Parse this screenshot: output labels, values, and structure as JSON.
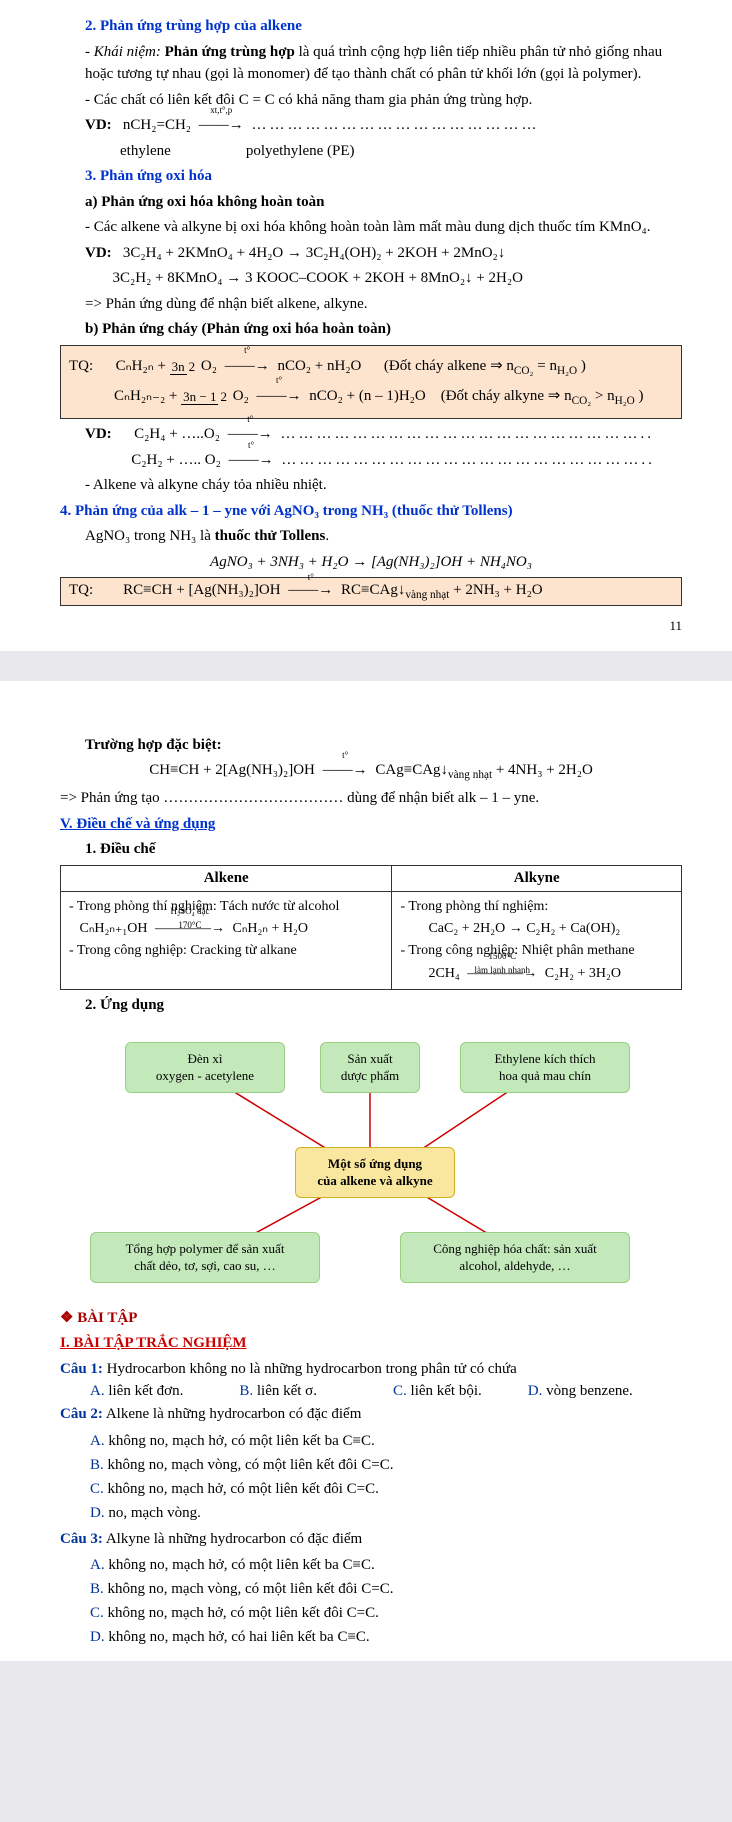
{
  "p1": {
    "h2": "2. Phản ứng trùng hợp của alkene",
    "khai_niem_label": "- Khái niệm:",
    "khai_niem": " Phản ứng trùng hợp",
    "khai_niem_text": " là quá trình cộng hợp liên tiếp nhiều phân tử nhỏ giống nhau hoặc tương tự nhau (gọi là monomer) để tạo thành chất có phân tử khối lớn (gọi là polymer).",
    "line_cc": "- Các chất có liên kết đôi C = C có khả năng tham gia phản ứng trùng hợp.",
    "vd_label": "VD:",
    "vd_eq": "nCH₂=CH₂",
    "vd_cond": "xt,t°,p",
    "vd_dots": "…………………………………………",
    "ethylene": "ethylene",
    "pe": "polyethylene (PE)",
    "h3": "3. Phản ứng oxi hóa",
    "h3a": "a) Phản ứng oxi hóa không hoàn toàn",
    "oxi_text": "- Các alkene và alkyne bị oxi hóa không hoàn toàn làm mất màu dung dịch thuốc tím KMnO₄.",
    "vd2_l1": "3C₂H₄ + 2KMnO₄ + 4H₂O → 3C₂H₄(OH)₂ + 2KOH + 2MnO₂↓",
    "vd2_l2": "3C₂H₂ + 8KMnO₄ → 3 KOOC–COOK + 2KOH + 8MnO₂↓ + 2H₂O",
    "nhan_biet": "=> Phản ứng dùng để nhận biết alkene, alkyne.",
    "h3b": "b) Phản ứng cháy (Phản ứng oxi hóa hoàn toàn)",
    "tq_label": "TQ:",
    "tq_eq1_left": "CₙH₂ₙ + ",
    "tq_eq1_frac_t": "3n",
    "tq_eq1_frac_b": "2",
    "tq_eq1_right": " O₂",
    "tq_eq1_prod": "nCO₂ + nH₂O",
    "tq_eq1_note": "(Đốt cháy alkene ⇒ n",
    "tq_eq1_co2": "CO₂",
    "tq_eq1_eq": " = n",
    "tq_eq1_h2o": "H₂O",
    "tq_eq1_close": " )",
    "tq_eq2_left": "CₙH₂ₙ₋₂ + ",
    "tq_eq2_frac_t": "3n − 1",
    "tq_eq2_frac_b": "2",
    "tq_eq2_prod": "nCO₂ + (n – 1)H₂O",
    "tq_eq2_note": "(Đốt cháy alkyne ⇒ n",
    "tq_eq2_gt": " > n",
    "vd3_l1": "C₂H₄  +  …..O₂",
    "vd3_dots": "……………………………………………………..",
    "vd3_l2": "C₂H₂  +  ….. O₂",
    "heat_note": "- Alkene và alkyne cháy tỏa nhiều nhiệt.",
    "h4": "4. Phản ứng của alk – 1 – yne với AgNO₃ trong NH₃ (thuốc thử Tollens)",
    "tollens": "AgNO₃ trong NH₃ là ",
    "tollens_bold": "thuốc thử Tollens",
    "tollens_eq": "AgNO₃ + 3NH₃ + H₂O → [Ag(NH₃)₂]OH + NH₄NO₃",
    "tq2_left": "RC≡CH + [Ag(NH₃)₂]OH",
    "tq2_right": "RC≡CAg↓",
    "tq2_vang": "vàng nhạt",
    "tq2_end": " + 2NH₃ + H₂O",
    "page_num": "11"
  },
  "p2": {
    "special": "Trường hợp đặc biệt:",
    "special_eq_l": "CH≡CH + 2[Ag(NH₃)₂]OH",
    "special_eq_r": "CAg≡CAg↓",
    "special_vang": "vàng nhạt",
    "special_end": " + 4NH₃ + 2H₂O",
    "pu_tao": "=> Phản ứng tạo ……………………………… dùng để nhận biết alk – 1 – yne.",
    "hV": "V. Điều chế và ứng dụng",
    "h1": "1. Điều chế",
    "th_alkene": "Alkene",
    "th_alkyne": "Alkyne",
    "alkene_l1": "- Trong phòng thí nghiệm: Tách nước từ alcohol",
    "alkene_eq_l": "CₙH₂ₙ₊₁OH",
    "alkene_cond_t": "H₂SO₄ đặc",
    "alkene_cond_b": "170°C",
    "alkene_eq_r": "CₙH₂ₙ + H₂O",
    "alkene_l2": "- Trong công nghiệp: Cracking từ alkane",
    "alkyne_l1": "- Trong phòng thí nghiệm:",
    "alkyne_eq1": "CaC₂ + 2H₂O → C₂H₂ + Ca(OH)₂",
    "alkyne_l2": "- Trong công nghiệp: Nhiệt phân methane",
    "alkyne_eq2_l": "2CH₄",
    "alkyne_cond_t": "1500°C",
    "alkyne_cond_b": "làm lạnh nhanh",
    "alkyne_eq2_r": "C₂H₂ + 3H₂O",
    "h2_ud": "2. Ứng dụng",
    "node_denxi": "Đèn xì\noxygen - acetylene",
    "node_duoc": "Sản xuất\ndược phẩm",
    "node_eth": "Ethylene kích thích\nhoa quả mau chín",
    "node_center": "Một số ứng dụng\ncủa alkene và alkyne",
    "node_polymer": "Tổng hợp polymer để sản xuất\nchất dẻo, tơ, sợi, cao su, …",
    "node_cn": "Công nghiệp hóa chất: sản xuất\nalcohol, aldehyde, …",
    "bai_tap": "❖ BÀI TẬP",
    "bt_trac": "I.  BÀI TẬP TRẮC NGHIỆM",
    "q1": "Câu 1:",
    "q1_text": " Hydrocarbon không no là những hydrocarbon trong phân tử có chứa",
    "q1a": "A.",
    "q1a_t": " liên kết đơn.",
    "q1b": "B.",
    "q1b_t": " liên kết σ.",
    "q1c": "C.",
    "q1c_t": " liên kết bội.",
    "q1d": "D.",
    "q1d_t": " vòng benzene.",
    "q2": "Câu 2:",
    "q2_text": " Alkene là những hydrocarbon có đặc điểm",
    "q2a": " không no, mạch hở, có một liên kết ba C≡C.",
    "q2b": " không no, mạch vòng, có một liên kết đôi C=C.",
    "q2c": " không no, mạch hở, có một liên kết đôi C=C.",
    "q2d": " no, mạch vòng.",
    "q3": "Câu 3:",
    "q3_text": " Alkyne là những hydrocarbon có đặc điểm",
    "q3a": " không no, mạch hở, có một liên kết ba C≡C.",
    "q3b": " không no, mạch vòng, có một liên kết đôi C=C.",
    "q3c": " không no, mạch hở, có một liên kết đôi C=C.",
    "q3d": " không no, mạch hở, có hai liên kết ba C≡C."
  }
}
